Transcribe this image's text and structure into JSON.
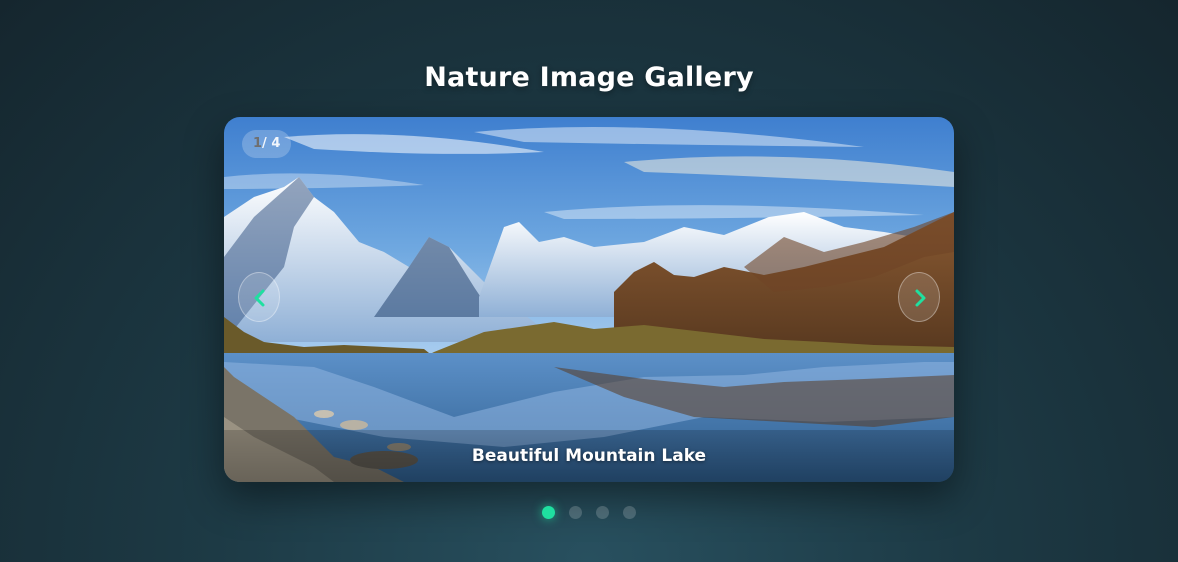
{
  "page": {
    "title": "Nature Image Gallery"
  },
  "gallery": {
    "current_index": "1",
    "separator_total": "/ 4",
    "caption": "Beautiful Mountain Lake",
    "prev_icon": "chevron-left-icon",
    "next_icon": "chevron-right-icon",
    "slide_count": 4,
    "active_slide": 1
  },
  "colors": {
    "accent": "#1fe0a0",
    "background": "#1b3038"
  }
}
